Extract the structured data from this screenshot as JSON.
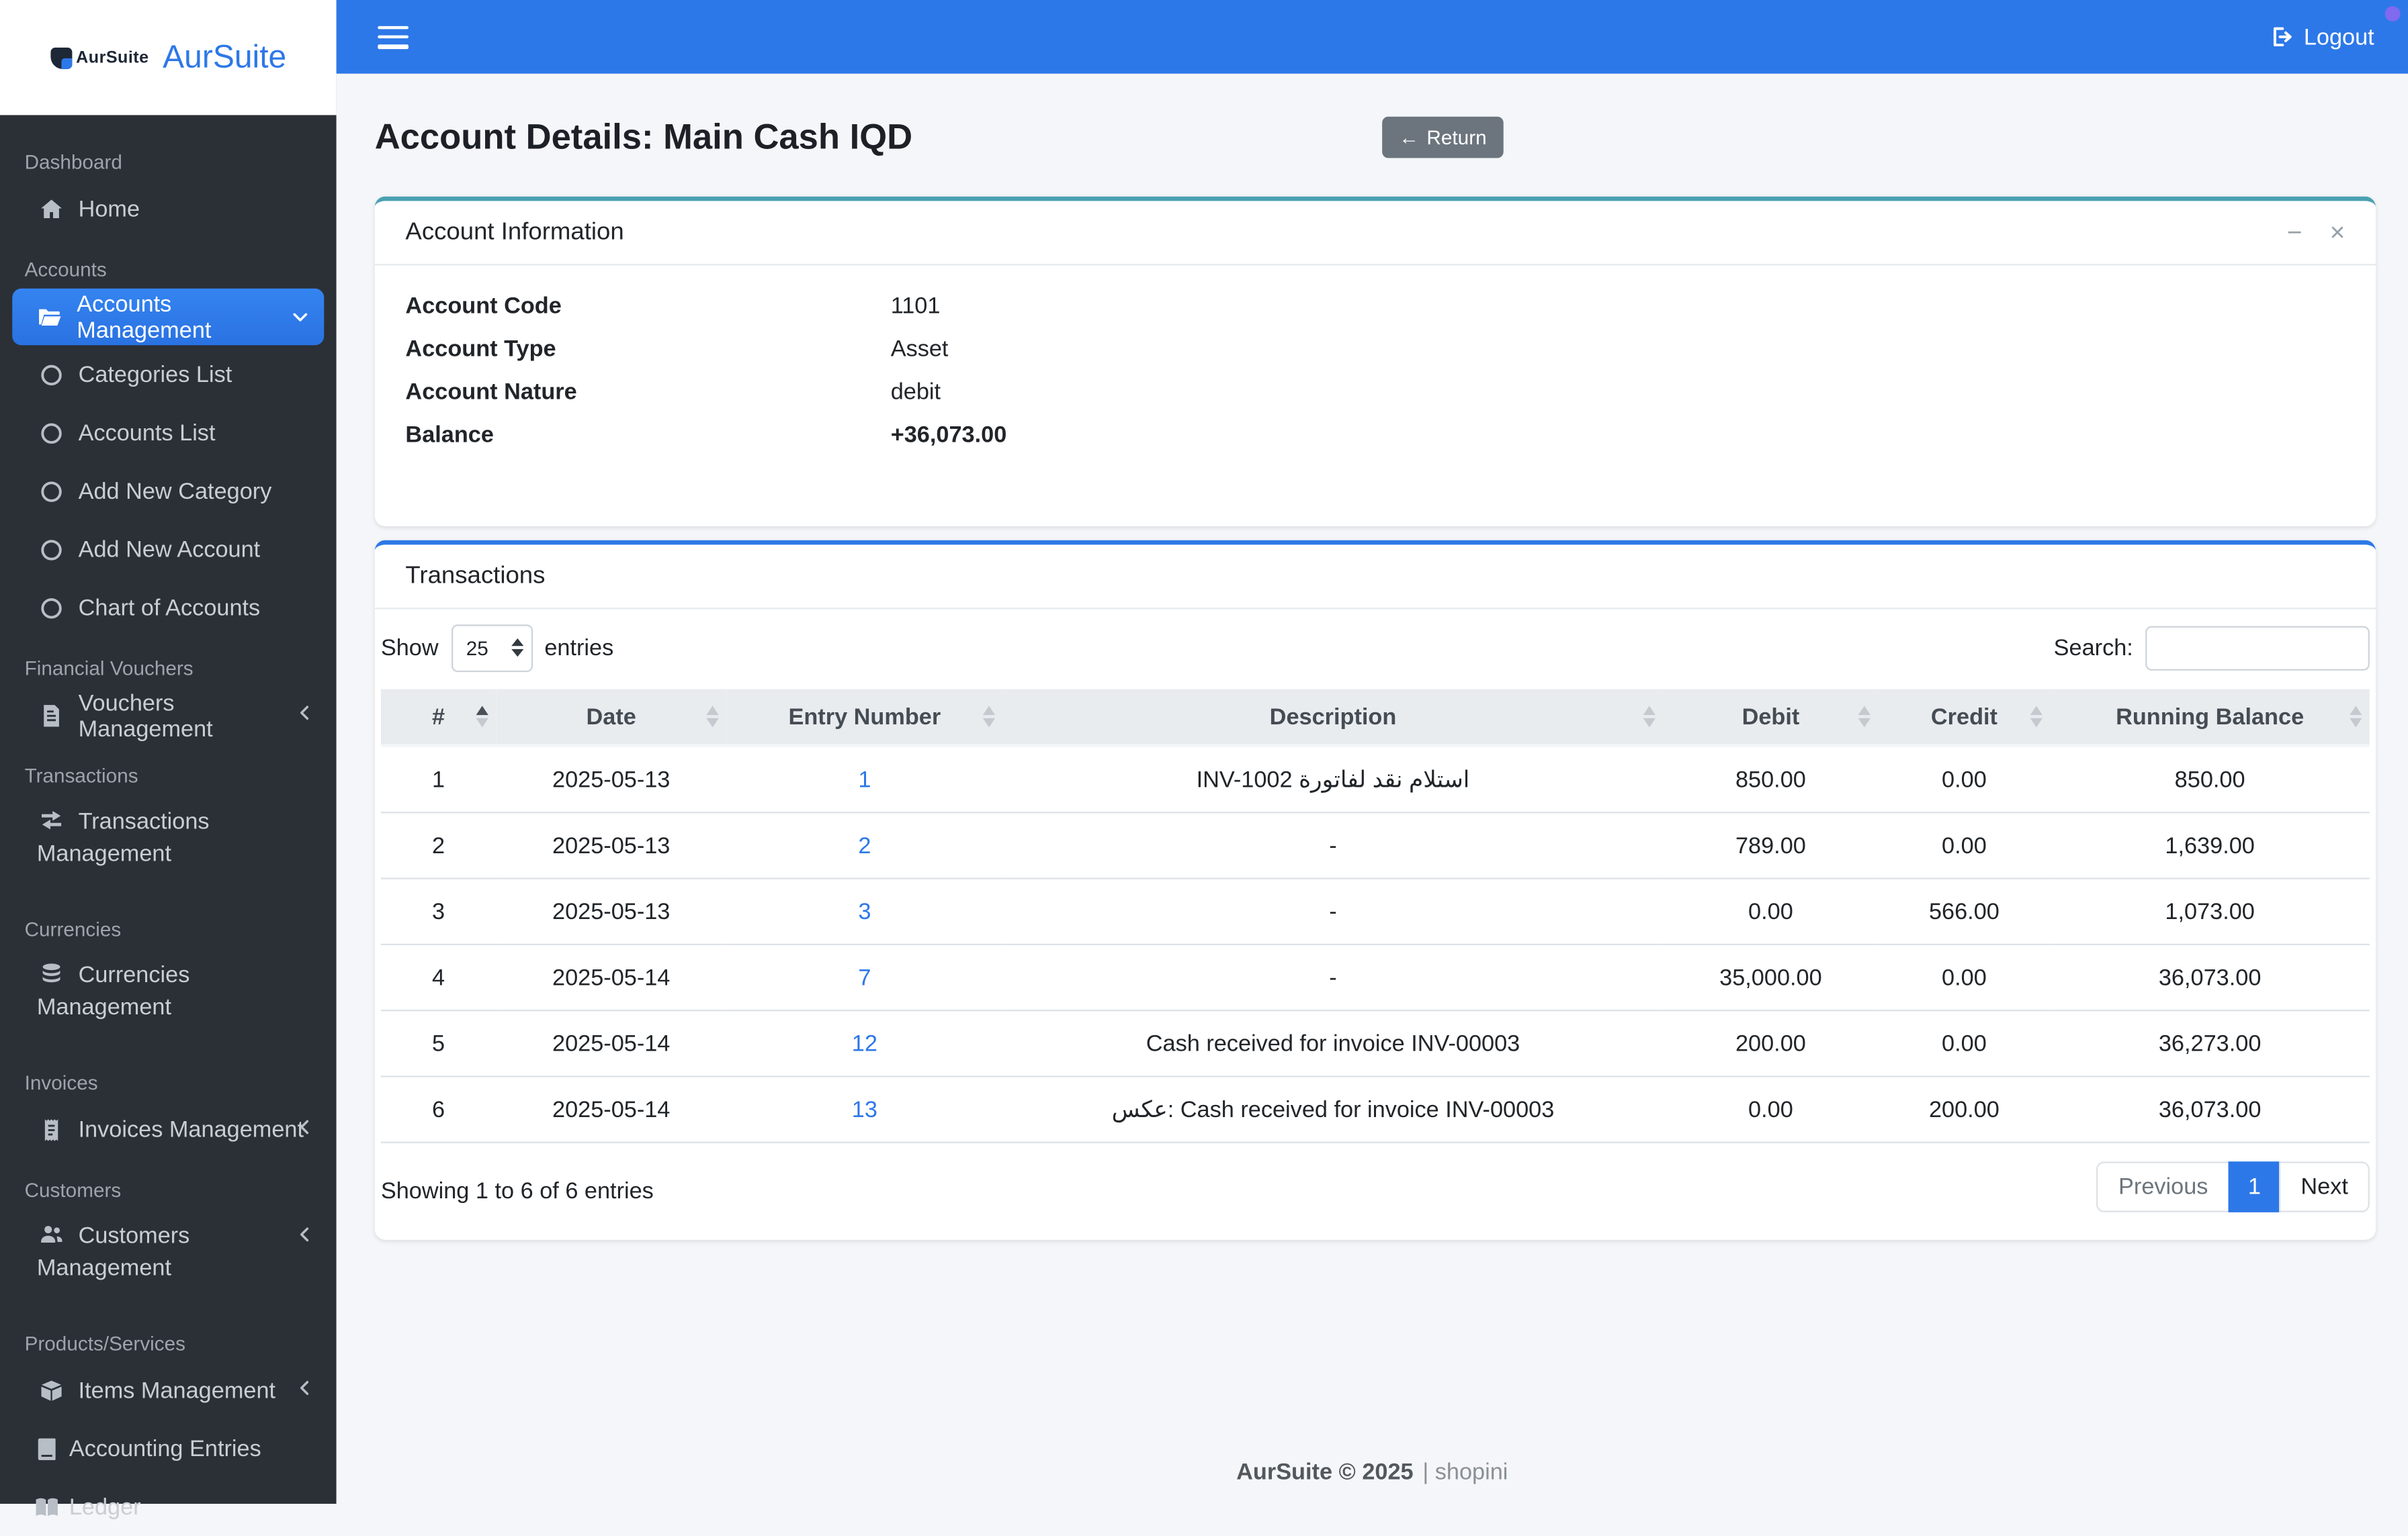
{
  "app": {
    "logo_text": "AurSuite",
    "brand": "AurSuite"
  },
  "topbar": {
    "logout_label": "Logout"
  },
  "page": {
    "title": "Account Details: Main Cash IQD",
    "return_label": "Return",
    "return_arrow": "←"
  },
  "icons": {
    "minimize": "−",
    "close": "×"
  },
  "sidebar": {
    "sections": [
      {
        "label": "Dashboard",
        "items": [
          {
            "icon": "home",
            "label": "Home"
          }
        ]
      },
      {
        "label": "Accounts",
        "items": [
          {
            "icon": "folder-open",
            "label": "Accounts Management",
            "active": true,
            "chevron": "down"
          },
          {
            "icon": "circle",
            "label": "Categories List"
          },
          {
            "icon": "circle",
            "label": "Accounts List"
          },
          {
            "icon": "circle",
            "label": "Add New Category"
          },
          {
            "icon": "circle",
            "label": "Add New Account"
          },
          {
            "icon": "circle",
            "label": "Chart of Accounts"
          }
        ]
      },
      {
        "label": "Financial Vouchers",
        "items": [
          {
            "icon": "file-invoice",
            "label": "Vouchers Management",
            "chevron": "left"
          }
        ]
      },
      {
        "label": "Transactions",
        "items": [
          {
            "icon": "exchange",
            "label": "Transactions Management",
            "two_line": true
          }
        ]
      },
      {
        "label": "Currencies",
        "items": [
          {
            "icon": "coins",
            "label": "Currencies Management",
            "two_line": true
          }
        ]
      },
      {
        "label": "Invoices",
        "items": [
          {
            "icon": "receipt",
            "label": "Invoices Management",
            "chevron": "left"
          }
        ]
      },
      {
        "label": "Customers",
        "items": [
          {
            "icon": "users",
            "label": "Customers Management",
            "two_line": true,
            "chevron": "left"
          }
        ]
      },
      {
        "label": "Products/Services",
        "items": [
          {
            "icon": "box",
            "label": "Items Management",
            "chevron": "left"
          },
          {
            "icon": "book",
            "label": "Accounting Entries",
            "flush": true
          },
          {
            "icon": "book-open",
            "label": "Ledger",
            "flush": true
          }
        ]
      }
    ]
  },
  "account_info": {
    "title": "Account Information",
    "rows": [
      {
        "label": "Account Code",
        "value": "1101",
        "bold": false
      },
      {
        "label": "Account Type",
        "value": "Asset",
        "bold": false
      },
      {
        "label": "Account Nature",
        "value": "debit",
        "bold": false
      },
      {
        "label": "Balance",
        "value": "+36,073.00",
        "bold": true
      }
    ]
  },
  "transactions": {
    "title": "Transactions",
    "controls": {
      "show_label": "Show",
      "page_size": "25",
      "entries_label": "entries",
      "search_label": "Search:",
      "search_value": ""
    },
    "columns": [
      "#",
      "Date",
      "Entry Number",
      "Description",
      "Debit",
      "Credit",
      "Running Balance"
    ],
    "rows": [
      {
        "num": "1",
        "date": "2025-05-13",
        "entry": "1",
        "desc": "استلام نقد لفاتورة INV-1002",
        "dir": "rtl",
        "debit": "850.00",
        "credit": "0.00",
        "balance": "850.00"
      },
      {
        "num": "2",
        "date": "2025-05-13",
        "entry": "2",
        "desc": "-",
        "dir": "ltr",
        "debit": "789.00",
        "credit": "0.00",
        "balance": "1,639.00"
      },
      {
        "num": "3",
        "date": "2025-05-13",
        "entry": "3",
        "desc": "-",
        "dir": "ltr",
        "debit": "0.00",
        "credit": "566.00",
        "balance": "1,073.00"
      },
      {
        "num": "4",
        "date": "2025-05-14",
        "entry": "7",
        "desc": "-",
        "dir": "ltr",
        "debit": "35,000.00",
        "credit": "0.00",
        "balance": "36,073.00"
      },
      {
        "num": "5",
        "date": "2025-05-14",
        "entry": "12",
        "desc": "Cash received for invoice INV-00003",
        "dir": "ltr",
        "debit": "200.00",
        "credit": "0.00",
        "balance": "36,273.00"
      },
      {
        "num": "6",
        "date": "2025-05-14",
        "entry": "13",
        "desc": "عكس: Cash received for invoice INV-00003",
        "dir": "ltr",
        "debit": "0.00",
        "credit": "200.00",
        "balance": "36,073.00"
      }
    ],
    "info": "Showing 1 to 6 of 6 entries",
    "pagination": {
      "previous": "Previous",
      "current": "1",
      "next": "Next"
    }
  },
  "footer": {
    "brand": "AurSuite © 2025",
    "sub": "| shopini"
  },
  "colors": {
    "accent_blue": "#2d78e8",
    "accent_teal": "#49a1b2",
    "sidebar_bg": "#2b3036",
    "secondary": "#6c757d"
  }
}
